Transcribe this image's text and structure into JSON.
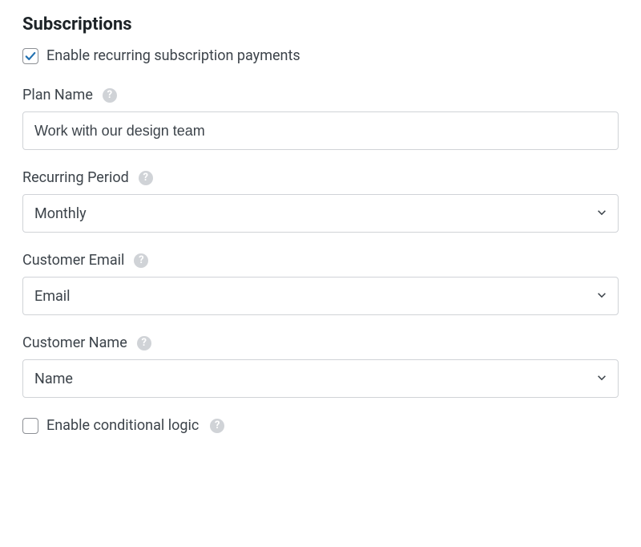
{
  "section": {
    "title": "Subscriptions"
  },
  "enable_subscriptions": {
    "label": "Enable recurring subscription payments",
    "checked": true
  },
  "plan_name": {
    "label": "Plan Name",
    "value": "Work with our design team"
  },
  "recurring_period": {
    "label": "Recurring Period",
    "value": "Monthly"
  },
  "customer_email": {
    "label": "Customer Email",
    "value": "Email"
  },
  "customer_name": {
    "label": "Customer Name",
    "value": "Name"
  },
  "conditional_logic": {
    "label": "Enable conditional logic",
    "checked": false
  }
}
